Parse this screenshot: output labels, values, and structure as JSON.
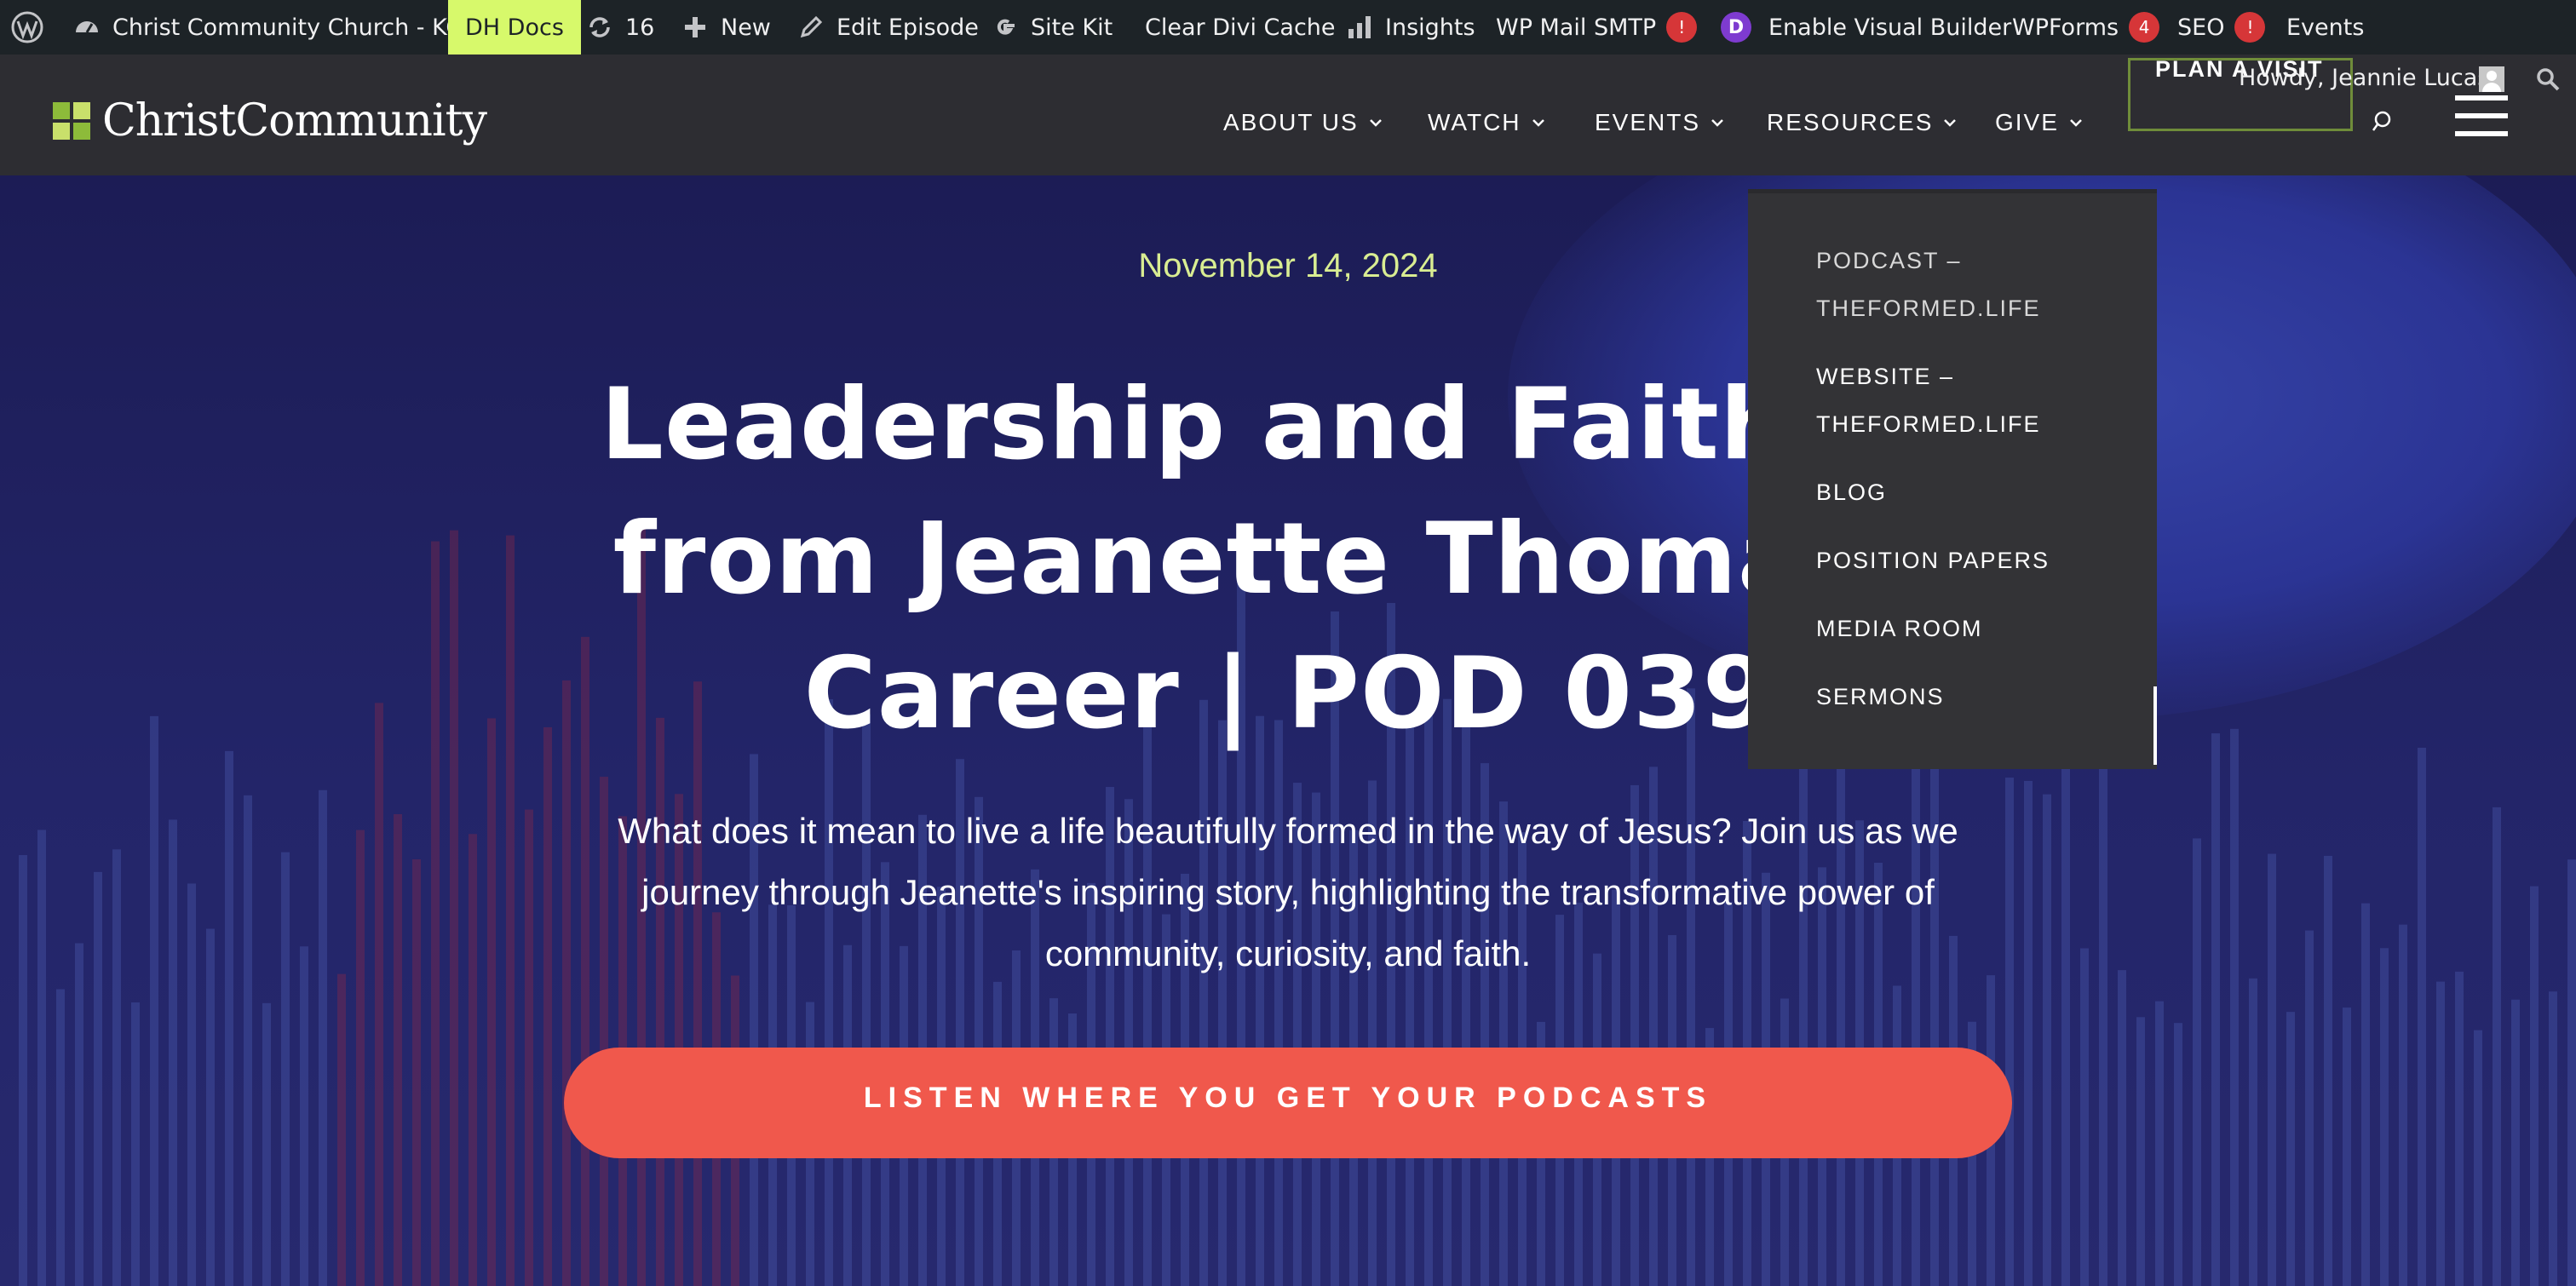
{
  "admin_bar": {
    "site_name": "Christ Community Church - KC",
    "dh_docs": "DH Docs",
    "updates_count": "16",
    "new": "New",
    "edit_episode": "Edit Episode",
    "site_kit": "Site Kit",
    "clear_divi_cache": "Clear Divi Cache",
    "insights": "Insights",
    "wp_mail_smtp": "WP Mail SMTP",
    "wp_mail_smtp_badge": "!",
    "divi_letter": "D",
    "enable_visual_builder": "Enable Visual Builder",
    "wpforms": "WPForms",
    "wpforms_badge": "4",
    "seo": "SEO",
    "seo_badge": "!",
    "events": "Events",
    "howdy": "Howdy, Jeannie Lucas"
  },
  "header": {
    "logo_text": "ChristCommunity",
    "nav": [
      "ABOUT US",
      "WATCH",
      "EVENTS",
      "RESOURCES",
      "GIVE"
    ],
    "plan_visit": "PLAN A VISIT"
  },
  "resources_menu": [
    "PODCAST – THEFORMED.LIFE",
    "WEBSITE – THEFORMED.LIFE",
    "BLOG",
    "POSITION PAPERS",
    "MEDIA ROOM",
    "SERMONS"
  ],
  "hero": {
    "date": "November 14, 2024",
    "title_lines": [
      "Leadership and Faith: In",
      "from Jeanette Thomas’s",
      "Career | POD 039"
    ],
    "description": "What does it mean to live a life beautifully formed in the way of Jesus? Join us as we journey through Jeanette's inspiring story, highlighting the transformative power of community, curiosity, and faith.",
    "cta": "LISTEN WHERE YOU GET YOUR PODCASTS"
  },
  "colors": {
    "admin_bar": "#1d2327",
    "dh_docs_bg": "#d7f96b",
    "header": "#2d2d32",
    "hero_bg": "#1d1c4f",
    "date_accent": "#d9ed92",
    "cta": "#f0584c",
    "dropdown": "#333336",
    "plan_visit_border": "#6f8c3a"
  }
}
